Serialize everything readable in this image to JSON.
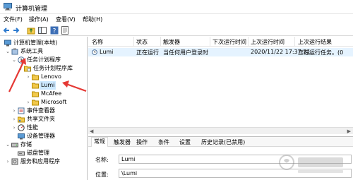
{
  "window": {
    "title": "计算机管理"
  },
  "menu": [
    "文件(F)",
    "操作(A)",
    "查看(V)",
    "帮助(H)"
  ],
  "tree": {
    "root": "计算机管理(本地)",
    "system_tools": "系统工具",
    "task_scheduler": "任务计划程序",
    "task_library": "任务计划程序库",
    "folders": [
      "Lenovo",
      "Lumi",
      "McAfee",
      "Microsoft"
    ],
    "event_viewer": "事件查看器",
    "shared_folders": "共享文件夹",
    "performance": "性能",
    "device_manager": "设备管理器",
    "storage": "存储",
    "disk_management": "磁盘管理",
    "services_apps": "服务和应用程序"
  },
  "list": {
    "columns": [
      "名称",
      "状态",
      "触发器",
      "下次运行时间",
      "上次运行时间",
      "上次运行结果"
    ],
    "rows": [
      {
        "name": "Lumi",
        "status": "正在运行",
        "trigger": "当任何用户登录时",
        "next_run": "",
        "last_run": "2020/11/22 17:37:51",
        "last_result": "正在运行任务。(0"
      }
    ]
  },
  "details": {
    "tabs": [
      "常规",
      "触发器",
      "操作",
      "条件",
      "设置",
      "历史记录(已禁用)"
    ],
    "name_label": "名称:",
    "name_value": "Lumi",
    "location_label": "位置:",
    "location_value": "\\Lumi"
  },
  "icons": {
    "back": "back-arrow-icon",
    "forward": "forward-arrow-icon",
    "up": "up-folder-icon",
    "console": "console-tree-icon",
    "help": "help-icon",
    "properties": "properties-icon"
  },
  "colors": {
    "selection": "#cce8ff",
    "row_highlight": "#e5f3ff",
    "annotation_red": "#e53935"
  }
}
